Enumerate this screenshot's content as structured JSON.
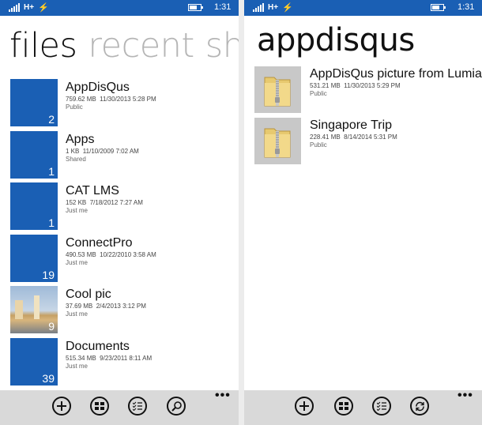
{
  "left": {
    "status": {
      "network": "H+",
      "time": "1:31",
      "battery_level": 0.7
    },
    "pivot": {
      "tabs": [
        "files",
        "recent",
        "shared"
      ],
      "active": "files"
    },
    "items": [
      {
        "name": "AppDisQus",
        "size": "759.62 MB",
        "date": "11/30/2013 5:28 PM",
        "sharing": "Public",
        "count": "2",
        "thumb": "folder"
      },
      {
        "name": "Apps",
        "size": "1 KB",
        "date": "11/10/2009 7:02 AM",
        "sharing": "Shared",
        "count": "1",
        "thumb": "folder"
      },
      {
        "name": "CAT LMS",
        "size": "152 KB",
        "date": "7/18/2012 7:27 AM",
        "sharing": "Just me",
        "count": "1",
        "thumb": "folder"
      },
      {
        "name": "ConnectPro",
        "size": "490.53 MB",
        "date": "10/22/2010 3:58 AM",
        "sharing": "Just me",
        "count": "19",
        "thumb": "folder"
      },
      {
        "name": "Cool pic",
        "size": "37.69 MB",
        "date": "2/4/2013 3:12 PM",
        "sharing": "Just me",
        "count": "9",
        "thumb": "photo"
      },
      {
        "name": "Documents",
        "size": "515.34 MB",
        "date": "9/23/2011 8:11 AM",
        "sharing": "Just me",
        "count": "39",
        "thumb": "folder"
      }
    ],
    "appbar": {
      "buttons": [
        {
          "icon": "add-icon"
        },
        {
          "icon": "select-icon"
        },
        {
          "icon": "multi-select-icon"
        },
        {
          "icon": "search-icon"
        }
      ],
      "more": "•••"
    }
  },
  "right": {
    "status": {
      "network": "H+",
      "time": "1:31",
      "battery_level": 0.7
    },
    "title": "appdisqus",
    "items": [
      {
        "name": "AppDisQus picture from Lumia",
        "size": "531.21 MB",
        "date": "11/30/2013 5:29 PM",
        "sharing": "Public"
      },
      {
        "name": "Singapore Trip",
        "size": "228.41 MB",
        "date": "8/14/2014 5:31 PM",
        "sharing": "Public"
      }
    ],
    "appbar": {
      "buttons": [
        {
          "icon": "add-icon"
        },
        {
          "icon": "select-icon"
        },
        {
          "icon": "multi-select-icon"
        },
        {
          "icon": "sync-icon"
        }
      ],
      "more": "•••"
    }
  },
  "colors": {
    "accent": "#1a5fb4",
    "appbar": "#d9d9d9",
    "folder_tile": "#c8c8c8"
  }
}
